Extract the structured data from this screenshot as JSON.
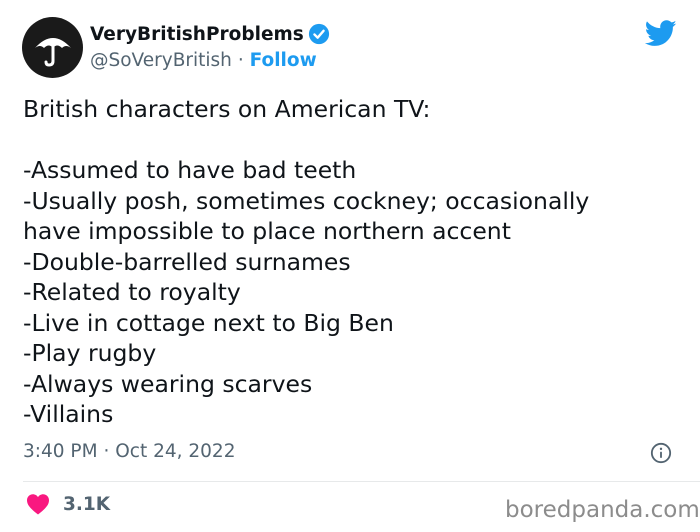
{
  "author": {
    "display_name": "VeryBritishProblems",
    "handle": "@SoVeryBritish",
    "separator": "·",
    "follow_label": "Follow",
    "avatar_icon": "umbrella-icon",
    "verified_icon": "verified-badge-icon"
  },
  "platform_icon": "twitter-bird-icon",
  "tweet": {
    "lines": [
      "British characters on American TV:",
      "",
      "-Assumed to have bad teeth",
      "-Usually posh, sometimes cockney; occasionally",
      "have impossible to place northern accent",
      "-Double-barrelled surnames",
      "-Related to royalty",
      "-Live in cottage next to Big Ben",
      "-Play rugby",
      "-Always wearing scarves",
      "-Villains"
    ]
  },
  "meta": {
    "time": "3:40 PM",
    "separator": "·",
    "date": "Oct 24, 2022",
    "info_icon": "info-icon"
  },
  "engagement": {
    "like_icon": "heart-icon",
    "like_count": "3.1K"
  },
  "watermark": "boredpanda.com",
  "colors": {
    "accent": "#1d9bf0",
    "text_primary": "#0f1419",
    "text_secondary": "#536471",
    "heart": "#f91880",
    "divider": "#e7e9ea"
  }
}
